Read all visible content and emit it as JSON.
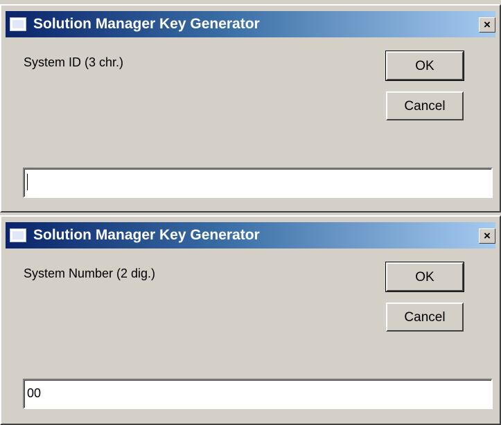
{
  "dialogs": [
    {
      "title": "Solution Manager Key Generator",
      "close_glyph": "×",
      "prompt": "System ID (3 chr.)",
      "ok_label": "OK",
      "cancel_label": "Cancel",
      "input_value": ""
    },
    {
      "title": "Solution Manager Key Generator",
      "close_glyph": "×",
      "prompt": "System Number (2 dig.)",
      "ok_label": "OK",
      "cancel_label": "Cancel",
      "input_value": "00"
    }
  ],
  "icons": {
    "app": "app-window-icon",
    "close": "close-icon"
  },
  "colors": {
    "titlebar_start": "#0a246a",
    "titlebar_end": "#a6caf0",
    "dialog_bg": "#d4d0c8"
  }
}
